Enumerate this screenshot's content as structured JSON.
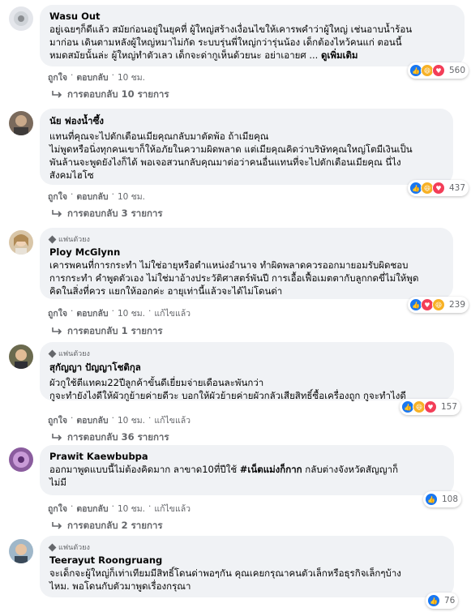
{
  "comments": [
    {
      "author": "Wasu Out",
      "badge": "",
      "lines": [
        "อยู่เฉยๆก็ดีแล้ว สมัยก่อนอยู่ในยุคที่ ผู้ใหญ่สร้างเงื่อนไขให้เคารพคำว่าผู้ใหญ่ เช่นอาบน้ำร้อน",
        "มาก่อน เดินตามหลังผู้ใหญ่หมาไม่กัด ระบบรุ่นพี่ใหญ่กว่ารุ่นน้อง เด็กต้องไหว้คนแก่ ตอนนี้",
        "หมดสมัยนั้นล่ะ ผู้ใหญ่ทำตัวเลว เด็กจะด่ากูเห็นด้วยนะ อย่าเอายศ ..."
      ],
      "see_more": "ดูเพิ่มเติม",
      "like": "ถูกใจ",
      "reply": "ตอบกลับ",
      "time": "10 ชม.",
      "edited": "",
      "reactions_count": "560",
      "replies_label": "การตอบกลับ 10 รายการ"
    },
    {
      "author": "นัย ฟองน้ำซึ้ง",
      "badge": "",
      "lines": [
        "แทนที่คุณจะไปตักเตือนเมียคุณกลับมาตัดพ้อ ถ้าเมียคุณ",
        "ไม่พูดหรือนิ่งทุกคนเขาก็ให้อภัยในความผิดพลาด แต่เมียคุณคิดว่าบริษัทคุณใหญ่โตมีเงินเป็น",
        "พันล้านจะพูดยังไงก็ได้ พอเจอสวนกลับคุณมาต่อว่าคนอื่นแทนที่จะไปตักเตือนเมียคุณ นี่ไง",
        "สังคมไฮโซ"
      ],
      "see_more": "",
      "like": "ถูกใจ",
      "reply": "ตอบกลับ",
      "time": "10 ชม.",
      "edited": "",
      "reactions_count": "437",
      "replies_label": "การตอบกลับ 3 รายการ"
    },
    {
      "author": "Ploy McGlynn",
      "badge": "แฟนตัวยง",
      "lines": [
        "เคารพคนที่การกระทำ ไม่ใช่อายุหรือตำแหน่งอำนาจ ทำผิดพลาดควรออกมายอมรับผิดชอบ",
        "การกระทำ คำพูดตัวเอง ไม่ใช่มาอ้างประวัติศาสตร์พันปี การเอื้อเฟื้อเมตตากับลูกกดขี่ไม่ให้พูด",
        "คิดในสิ่งที่ควร แยกให้ออกค่ะ อายุเท่านี้แล้วจะได้ไม่โดนด่า"
      ],
      "see_more": "",
      "like": "ถูกใจ",
      "reply": "ตอบกลับ",
      "time": "10 ชม.",
      "edited": "แก้ไขแล้ว",
      "reactions_count": "239",
      "replies_label": "การตอบกลับ 1 รายการ"
    },
    {
      "author": "สุกัญญา ปัญญาโชติกุล",
      "badge": "แฟนตัวยง",
      "lines": [
        "ผัวกูใช้ตีแทคม22ปีลูกค้าขั้นดีเยี่ยมจ่ายเดือนละพันกว่า",
        "กูจะทำยังไงดีให้ผัวกูย้ายค่ายดีวะ บอกให้ผัวย้ายค่ายผัวกลัวเสียสิทธิ์ซื้อเครื่องถูก กูจะทำไงดี"
      ],
      "see_more": "",
      "like": "ถูกใจ",
      "reply": "ตอบกลับ",
      "time": "10 ชม.",
      "edited": "แก้ไขแล้ว",
      "reactions_count": "157",
      "replies_label": "การตอบกลับ 36 รายการ"
    },
    {
      "author": "Prawit Kaewbubpa",
      "badge": "",
      "lines_pre": "ออกมาพูดแบบนี้ไม่ต้องคิดมาก ลาขาด10ที่ปีใช้ ",
      "hashtag": "#เน็ตแม่งก็กาก",
      "lines_post": " กลับต่างจังหวัดสัญญาก็",
      "lines_last": "ไม่มี",
      "like": "ถูกใจ",
      "reply": "ตอบกลับ",
      "time": "10 ชม.",
      "edited": "แก้ไขแล้ว",
      "reactions_count": "108",
      "replies_label": "การตอบกลับ 2 รายการ"
    },
    {
      "author": "Teerayut Roongruang",
      "badge": "แฟนตัวยง",
      "lines": [
        "จะเด็กจะผู้ใหญ่ก็เท่าเทียมมีสิทธิ์โดนด่าพอๆกัน คุณเคยกรุณาคนตัวเล็กหรือธุรกิจเล็กๆบ้าง",
        "ไหม. พอโดนกับตัวมาพูดเรื่องกรุณา"
      ],
      "see_more": "",
      "reactions_count": "76"
    }
  ],
  "colors": {
    "bubble": "#f0f2f5",
    "meta": "#65676b",
    "like": "#1877f2",
    "love": "#f33e58",
    "haha": "#f7b125"
  },
  "dot": "·"
}
